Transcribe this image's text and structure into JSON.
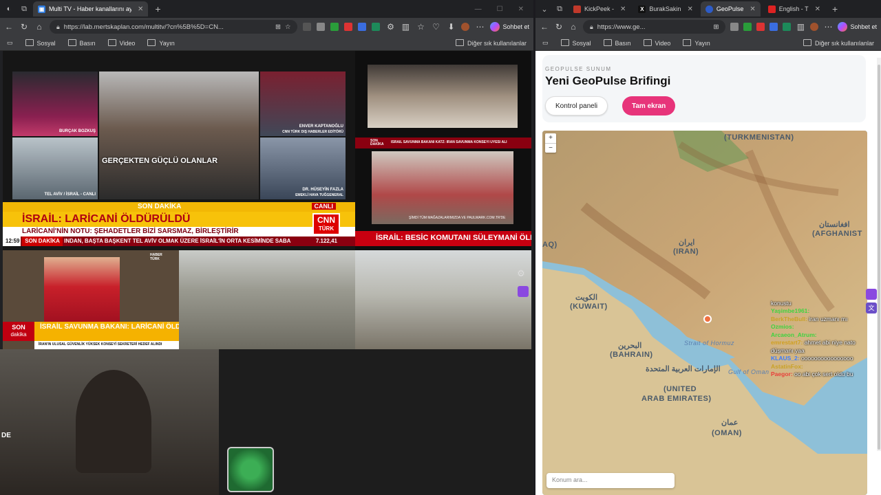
{
  "left_window": {
    "tabs": [
      {
        "label": "Multi TV - Haber kanallarını aynı a"
      }
    ],
    "url": "https://lab.mertskaplan.com/multitv/?cn%5B%5D=CN...",
    "chat_label": "Sohbet et",
    "bookmarks": [
      "Sosyal",
      "Basın",
      "Video",
      "Yayın"
    ],
    "bookmarks_more": "Diğer sık kullanılanlar",
    "tiles": {
      "cnn": {
        "names": [
          "BURÇAK BOZKUŞ",
          "ENVER KAPTANOĞLU",
          "CNN TÜRK DIŞ HABERLER EDİTÖRÜ",
          "TEL AVİV / İSRAİL - CANLI",
          "DR. HÜSEYİN FAZLA",
          "EMEKLİ HAVA TUĞGENERAL"
        ],
        "overlay": "GERÇEKTEN GÜÇLÜ OLANLAR",
        "flash": "SON DAKİKA",
        "live": "CANLI",
        "logo_top": "CNN",
        "logo_bottom": "TÜRK",
        "headline": "İSRAİL: LARİCANİ ÖLDÜRÜLDÜ",
        "subline": "LARİCANİ'NİN NOTU: ŞEHADETLER BİZİ SARSMAZ, BİRLEŞTİRİR",
        "time": "12:59",
        "ticker_label": "SON DAKİKA",
        "ticker": "INDAN, BAŞTA BAŞKENT TEL AVİV OLMAK ÜZERE İSRAİL'İN ORTA KESİMİNDE SABA",
        "ticker_num": "7.122,41"
      },
      "channel2": {
        "breaking": "SON DAKİKA",
        "bar": "İSRAİL SAVUNMA BAKANI KATZ: İRAN SAVUNMA KONSEYİ ÜYESİ ALİ EKBER AHMEDİYAN DA TAHRAN'DA ÖLDÜRÜLDÜ",
        "ad": "ŞİMDİ TÜM MAĞAZALARIMIZDA VE PAULMARK.COM.TR'DE",
        "headline": "İSRAİL: BESİC KOMUTANI SÜLEYMANİ ÖLDÜRÜLDÜ"
      },
      "channel3": {
        "logo": "HABER TÜRK",
        "flash_top": "SON",
        "flash_bottom": "dakika",
        "headline": "İSRAİL SAVUNMA BAKANI: LARİCANİ ÖLDÜ",
        "sub": "İRAN'IN ULUSAL GÜVENLİK YÜKSEK KONSEYİ SEKRETERİ HEDEF ALINDI"
      }
    },
    "streamer_tag": "DE"
  },
  "right_window": {
    "tabs": [
      {
        "label": "KickPeek -"
      },
      {
        "label": "BurakSakin"
      },
      {
        "label": "GeoPulse"
      },
      {
        "label": "English - T"
      }
    ],
    "url": "https://www.ge...",
    "chat_label": "Sohbet et",
    "bookmarks": [
      "Sosyal",
      "Basın",
      "Video",
      "Yayın"
    ],
    "bookmarks_more": "Diğer sık kullanılanlar",
    "page": {
      "kicker": "GEOPULSE SUNUM",
      "title": "Yeni GeoPulse Brifingi",
      "btn_panel": "Kontrol paneli",
      "btn_full": "Tam ekran",
      "search_placeholder": "Konum ara...",
      "map_labels": {
        "turkmenistan": "(TURKMENISTAN)",
        "iran_fa": "ایران",
        "iran": "(IRAN)",
        "afghan_fa": "افغانستان",
        "afghan": "(AFGHANIST",
        "kuwait_ar": "الكويت",
        "kuwait": "(KUWAIT)",
        "bahrain_ar": "البحرين",
        "bahrain": "(BAHRAIN)",
        "uae_ar": "الإمارات العربية المتحدة",
        "uae_1": "(UNITED",
        "uae_2": "ARAB EMIRATES)",
        "oman_ar": "عمان",
        "oman": "(OMAN)",
        "iraq": "AQ)",
        "hormuz": "Strait of Hormuz",
        "gulf_oman": "Gulf of Oman"
      },
      "chat": [
        {
          "user": "",
          "msg": "konustu",
          "color": "#ffffff"
        },
        {
          "user": "Yaşimbe1961:",
          "msg": "",
          "color": "#3fd33f"
        },
        {
          "user": "BerkTheBull:",
          "msg": "iran uzmanı mı",
          "color": "#c9a227"
        },
        {
          "user": "Ozmios:",
          "msg": "",
          "color": "#3fd33f"
        },
        {
          "user": "Arcaeon_Atrum:",
          "msg": "",
          "color": "#3fd33f"
        },
        {
          "user": "emrestart7:",
          "msg": "ahmet abi niye nato düşmanı yaa",
          "color": "#d0a020"
        },
        {
          "user": "KLAUS_2:",
          "msg": "oooooooooooooooo",
          "color": "#3a7bff"
        },
        {
          "user": "AstatinFox:",
          "msg": "",
          "color": "#c9a227"
        },
        {
          "user": "Paegor:",
          "msg": "oo abi çok sert oldu bu",
          "color": "#e8403a"
        }
      ]
    }
  }
}
